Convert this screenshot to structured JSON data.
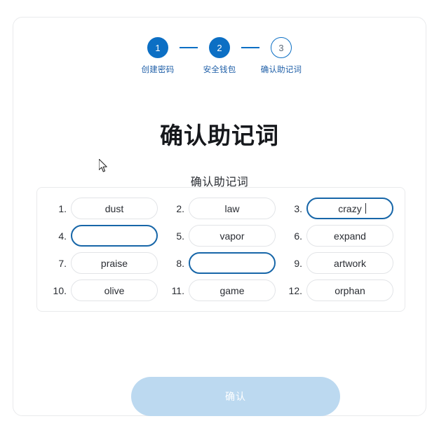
{
  "stepper": {
    "steps": [
      {
        "number": "1",
        "label": "创建密码",
        "state": "done"
      },
      {
        "number": "2",
        "label": "安全钱包",
        "state": "done"
      },
      {
        "number": "3",
        "label": "确认助记词",
        "state": "pending"
      }
    ]
  },
  "heading": {
    "title": "确认助记词",
    "subtitle": "确认助记词"
  },
  "words": [
    {
      "num": "1.",
      "value": "dust",
      "focused": false
    },
    {
      "num": "2.",
      "value": "law",
      "focused": false
    },
    {
      "num": "3.",
      "value": "crazy",
      "focused": true
    },
    {
      "num": "4.",
      "value": "",
      "focused": true
    },
    {
      "num": "5.",
      "value": "vapor",
      "focused": false
    },
    {
      "num": "6.",
      "value": "expand",
      "focused": false
    },
    {
      "num": "7.",
      "value": "praise",
      "focused": false
    },
    {
      "num": "8.",
      "value": "",
      "focused": true
    },
    {
      "num": "9.",
      "value": "artwork",
      "focused": false
    },
    {
      "num": "10.",
      "value": "olive",
      "focused": false
    },
    {
      "num": "11.",
      "value": "game",
      "focused": false
    },
    {
      "num": "12.",
      "value": "orphan",
      "focused": false
    }
  ],
  "actions": {
    "confirm_label": "确认"
  },
  "colors": {
    "accent": "#0c6fc4",
    "step_label": "#1f5fa8",
    "focus_border": "#1766a8",
    "button_disabled_bg": "#bcd9f0",
    "card_border": "#e9eaec",
    "input_border": "#e2e4e7"
  }
}
